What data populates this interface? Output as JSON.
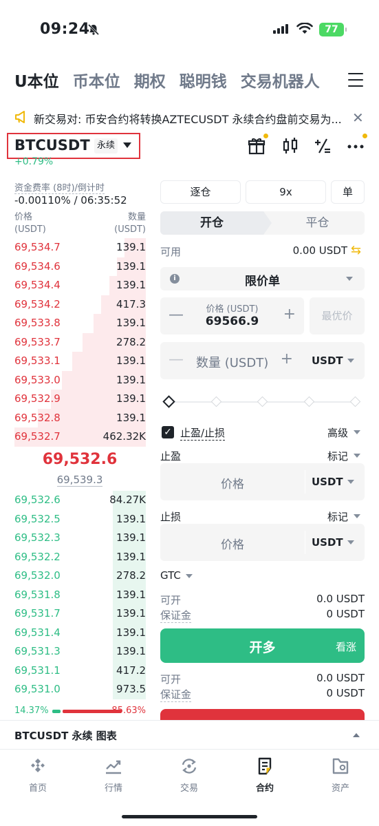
{
  "status": {
    "time": "09:24",
    "battery": "77"
  },
  "tabs": [
    {
      "label": "U本位",
      "active": true
    },
    {
      "label": "币本位"
    },
    {
      "label": "期权"
    },
    {
      "label": "聪明钱"
    },
    {
      "label": "交易机器人"
    }
  ],
  "notice": {
    "text": "新交易对: 币安合约将转换AZTECUSDT 永续合约盘前交易为..."
  },
  "symbol": {
    "name": "BTCUSDT",
    "type": "永续",
    "change": "+0.79%"
  },
  "funding": {
    "label": "资金费率 (8时)/倒计时",
    "value": "-0.00110% / 06:35:52"
  },
  "orderbook": {
    "price_header": "价格",
    "price_unit": "(USDT)",
    "qty_header": "数量",
    "qty_unit": "(USDT)",
    "asks": [
      {
        "price": "69,534.7",
        "qty": "139.1",
        "depth": 0.16
      },
      {
        "price": "69,534.6",
        "qty": "139.1",
        "depth": 0.22
      },
      {
        "price": "69,534.4",
        "qty": "139.1",
        "depth": 0.28
      },
      {
        "price": "69,534.2",
        "qty": "417.3",
        "depth": 0.34
      },
      {
        "price": "69,533.8",
        "qty": "139.1",
        "depth": 0.4
      },
      {
        "price": "69,533.7",
        "qty": "278.2",
        "depth": 0.48
      },
      {
        "price": "69,533.1",
        "qty": "139.1",
        "depth": 0.56
      },
      {
        "price": "69,533.0",
        "qty": "139.1",
        "depth": 0.64
      },
      {
        "price": "69,532.9",
        "qty": "139.1",
        "depth": 0.72
      },
      {
        "price": "69,532.8",
        "qty": "139.1",
        "depth": 0.82
      },
      {
        "price": "69,532.7",
        "qty": "462.32K",
        "depth": 1.0
      }
    ],
    "last_price": "69,532.6",
    "mark_price": "69,539.3",
    "bids": [
      {
        "price": "69,532.6",
        "qty": "84.27K",
        "depth": 0.25
      },
      {
        "price": "69,532.5",
        "qty": "139.1",
        "depth": 0.25
      },
      {
        "price": "69,532.3",
        "qty": "139.1",
        "depth": 0.25
      },
      {
        "price": "69,532.2",
        "qty": "139.1",
        "depth": 0.25
      },
      {
        "price": "69,532.0",
        "qty": "278.2",
        "depth": 0.25
      },
      {
        "price": "69,531.8",
        "qty": "139.1",
        "depth": 0.25
      },
      {
        "price": "69,531.7",
        "qty": "139.1",
        "depth": 0.25
      },
      {
        "price": "69,531.4",
        "qty": "139.1",
        "depth": 0.25
      },
      {
        "price": "69,531.3",
        "qty": "139.1",
        "depth": 0.25
      },
      {
        "price": "69,531.1",
        "qty": "417.2",
        "depth": 0.25
      },
      {
        "price": "69,531.0",
        "qty": "973.5",
        "depth": 0.25
      }
    ],
    "buy_ratio": "14.37%",
    "sell_ratio": "85.63%"
  },
  "order": {
    "margin_mode": "逐仓",
    "leverage": "9x",
    "position_mode": "单",
    "open_label": "开仓",
    "close_label": "平仓",
    "available_label": "可用",
    "available_value": "0.00 USDT",
    "order_type": "限价单",
    "price_label": "价格 (USDT)",
    "price_value": "69566.9",
    "best_price_label": "最优价",
    "qty_placeholder": "数量 (USDT)",
    "qty_unit": "USDT",
    "slider_percent": 0,
    "tpsl_label": "止盈/止损",
    "tpsl_checked": true,
    "advanced_label": "高级",
    "tp_label": "止盈",
    "sl_label": "止损",
    "trigger_type": "标记",
    "price_placeholder": "价格",
    "unit": "USDT",
    "tif": "GTC",
    "can_open_label": "可开",
    "margin_label": "保证金",
    "long_can_open": "0.0 USDT",
    "long_margin": "0 USDT",
    "buy_label": "开多",
    "buy_sub": "看涨",
    "short_can_open": "0.0 USDT",
    "short_margin": "0 USDT"
  },
  "chart_bar": {
    "label": "BTCUSDT 永续 图表"
  },
  "nav": [
    {
      "label": "首页",
      "icon": "home-icon"
    },
    {
      "label": "行情",
      "icon": "markets-icon"
    },
    {
      "label": "交易",
      "icon": "trade-icon"
    },
    {
      "label": "合约",
      "icon": "futures-icon",
      "active": true
    },
    {
      "label": "资产",
      "icon": "wallet-icon"
    }
  ],
  "colors": {
    "up": "#2ebd85",
    "down": "#e0333c",
    "accent": "#f0b90b"
  }
}
